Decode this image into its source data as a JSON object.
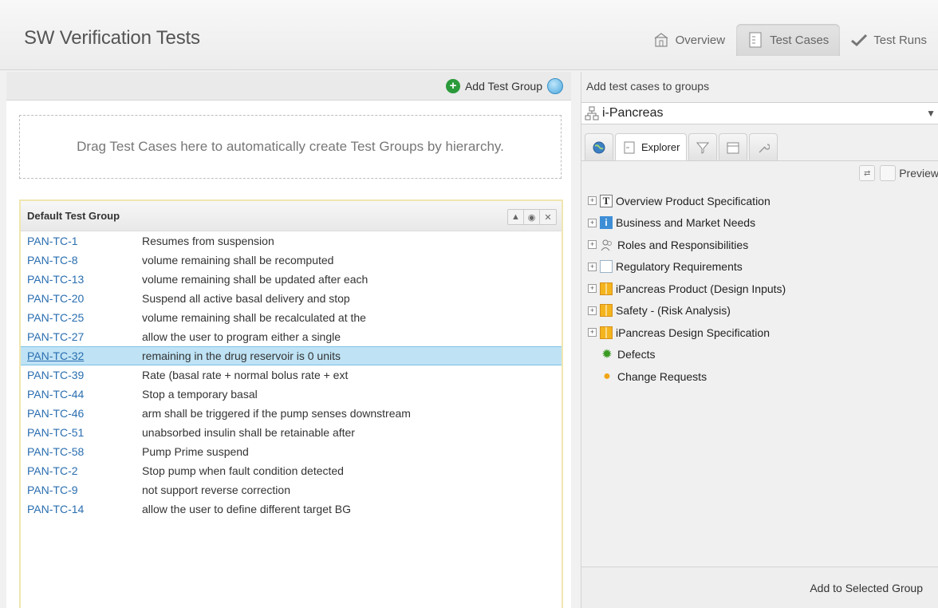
{
  "app": {
    "title": "SW Verification Tests"
  },
  "nav": {
    "tabs": [
      {
        "label": "Overview",
        "icon": "home-icon"
      },
      {
        "label": "Test Cases",
        "icon": "document-icon"
      },
      {
        "label": "Test Runs",
        "icon": "checkmark-icon"
      }
    ]
  },
  "left": {
    "add_group_label": "Add Test Group",
    "dropzone_text": "Drag Test Cases here to automatically create Test Groups by hierarchy.",
    "group_title": "Default Test Group",
    "rows": [
      {
        "id": "PAN-TC-1",
        "name": "Resumes from suspension"
      },
      {
        "id": "PAN-TC-8",
        "name": "volume remaining shall be recomputed"
      },
      {
        "id": "PAN-TC-13",
        "name": "volume remaining shall be updated after each"
      },
      {
        "id": "PAN-TC-20",
        "name": "Suspend all active basal delivery and stop"
      },
      {
        "id": "PAN-TC-25",
        "name": "volume remaining shall be recalculated at the"
      },
      {
        "id": "PAN-TC-27",
        "name": "allow the user to program either a single"
      },
      {
        "id": "PAN-TC-32",
        "name": "remaining in the drug reservoir is 0 units"
      },
      {
        "id": "PAN-TC-39",
        "name": "Rate (basal rate + normal bolus rate + ext"
      },
      {
        "id": "PAN-TC-44",
        "name": "Stop a temporary basal"
      },
      {
        "id": "PAN-TC-46",
        "name": "arm shall be triggered if the pump senses downstream"
      },
      {
        "id": "PAN-TC-51",
        "name": "unabsorbed insulin shall be retainable after"
      },
      {
        "id": "PAN-TC-58",
        "name": "Pump Prime suspend"
      },
      {
        "id": "PAN-TC-2",
        "name": "Stop pump when fault condition detected"
      },
      {
        "id": "PAN-TC-9",
        "name": "not support reverse correction"
      },
      {
        "id": "PAN-TC-14",
        "name": "allow the user to define different target BG"
      }
    ],
    "selected_row": "PAN-TC-32"
  },
  "right": {
    "caption": "Add test cases to groups",
    "project": "i-Pancreas",
    "explorer_tab": "Explorer",
    "preview_label": "Preview",
    "tree": [
      {
        "label": "Overview Product Specification",
        "icon": "text-icon",
        "expandable": true
      },
      {
        "label": "Business and Market Needs",
        "icon": "info-icon",
        "expandable": true
      },
      {
        "label": "Roles and Responsibilities",
        "icon": "people-icon",
        "expandable": true
      },
      {
        "label": "Regulatory Requirements",
        "icon": "document-icon",
        "expandable": true
      },
      {
        "label": "iPancreas Product (Design Inputs)",
        "icon": "grid-folder-icon",
        "expandable": true
      },
      {
        "label": "Safety - (Risk Analysis)",
        "icon": "grid-folder-icon",
        "expandable": true
      },
      {
        "label": "iPancreas Design Specification",
        "icon": "grid-folder-icon",
        "expandable": true
      },
      {
        "label": "Defects",
        "icon": "bug-icon",
        "expandable": false
      },
      {
        "label": "Change Requests",
        "icon": "lightbulb-icon",
        "expandable": false
      }
    ],
    "add_to_selected_label": "Add to Selected Group"
  },
  "colors": {
    "link": "#2a6eb0",
    "selected_row": "#bfe3f5",
    "accent_green": "#2a9a3a"
  }
}
